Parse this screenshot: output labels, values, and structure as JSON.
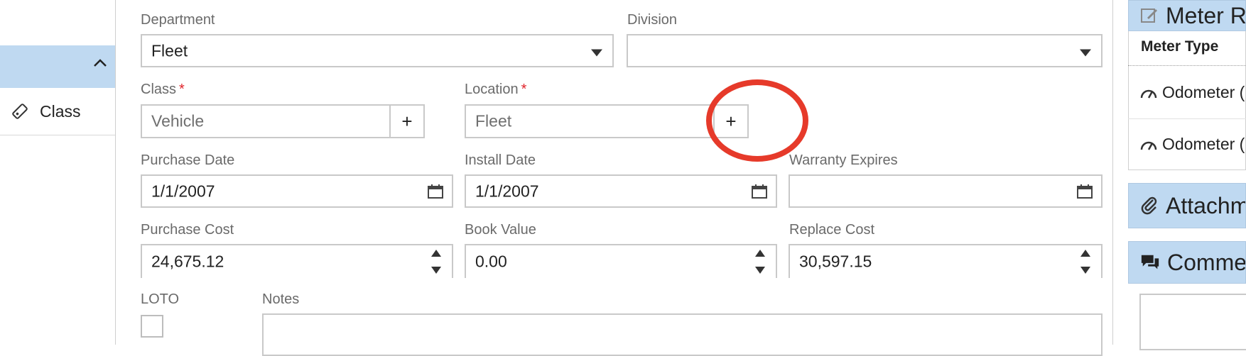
{
  "sidebar": {
    "item_label": "Class"
  },
  "form": {
    "department": {
      "label": "Department",
      "value": "Fleet"
    },
    "division": {
      "label": "Division",
      "value": ""
    },
    "class": {
      "label": "Class",
      "required_mark": "*",
      "placeholder": "Vehicle"
    },
    "location": {
      "label": "Location",
      "required_mark": "*",
      "placeholder": "Fleet"
    },
    "purchase_date": {
      "label": "Purchase Date",
      "value": "1/1/2007"
    },
    "install_date": {
      "label": "Install Date",
      "value": "1/1/2007"
    },
    "warranty_expires": {
      "label": "Warranty Expires",
      "value": ""
    },
    "purchase_cost": {
      "label": "Purchase Cost",
      "value": "24,675.12"
    },
    "book_value": {
      "label": "Book Value",
      "value": "0.00"
    },
    "replace_cost": {
      "label": "Replace Cost",
      "value": "30,597.15"
    },
    "loto": {
      "label": "LOTO",
      "checked": false
    },
    "notes": {
      "label": "Notes",
      "value": ""
    },
    "add_symbol": "+"
  },
  "right_panel": {
    "meter_title": "Meter R",
    "meter_col": "Meter Type",
    "meter_rows": [
      "Odometer (",
      "Odometer ("
    ],
    "attachments_title": "Attachm",
    "comments_title": "Comme"
  },
  "colors": {
    "header_blue": "#bfd9f1",
    "required_red": "#e0232a",
    "annotation_red": "#e63a2a"
  },
  "icons": {
    "sidebar_collapse": "chevron-up-icon",
    "class_item": "tag-icon",
    "meter": "edit-icon",
    "meter_row": "gauge-icon",
    "attachments": "paperclip-icon",
    "comments": "chat-icon",
    "calendar": "calendar-icon"
  }
}
